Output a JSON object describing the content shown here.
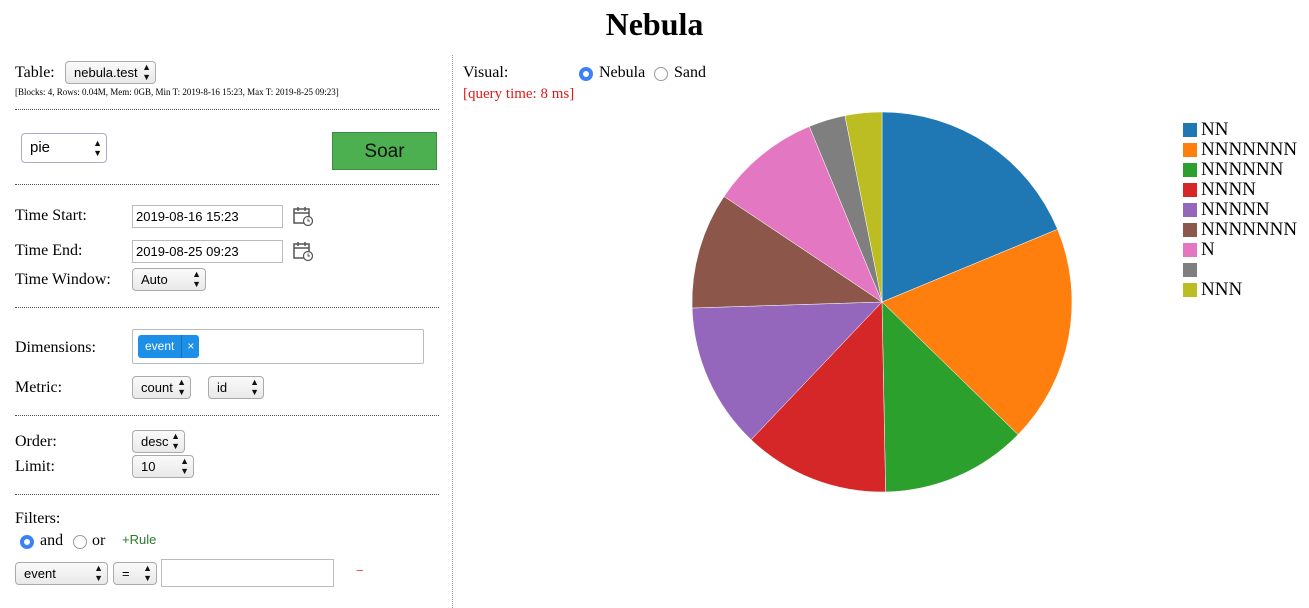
{
  "page": {
    "title": "Nebula"
  },
  "table": {
    "label": "Table:",
    "value": "nebula.test",
    "meta": "[Blocks: 4, Rows: 0.04M, Mem: 0GB, Min T: 2019-8-16 15:23, Max T: 2019-8-25 09:23]"
  },
  "chart_select": {
    "value": "pie"
  },
  "soar_button": {
    "label": "Soar"
  },
  "time": {
    "start_label": "Time Start:",
    "start_value": "2019-08-16 15:23",
    "end_label": "Time End:",
    "end_value": "2019-08-25 09:23",
    "window_label": "Time Window:",
    "window_value": "Auto"
  },
  "dimensions": {
    "label": "Dimensions:",
    "tag": "event",
    "tag_remove": "×"
  },
  "metric": {
    "label": "Metric:",
    "agg_value": "count",
    "field_value": "id"
  },
  "order": {
    "label": "Order:",
    "value": "desc"
  },
  "limit": {
    "label": "Limit:",
    "value": "10"
  },
  "filters": {
    "label": "Filters:",
    "and_label": "and",
    "or_label": "or",
    "add_rule": "+Rule",
    "field_value": "event",
    "op_value": "=",
    "input_value": "",
    "remove": "−"
  },
  "visual": {
    "label": "Visual:",
    "option_nebula": "Nebula",
    "option_sand": "Sand",
    "selected": "Nebula",
    "query_time": "[query time: 8 ms]"
  },
  "colors": {
    "accent": "#1e8fe6",
    "soar": "#4caf50",
    "query_time": "#e01a1a"
  },
  "chart_data": {
    "type": "pie",
    "title": "",
    "legend_placement": "right",
    "slices": [
      {
        "label": "NN",
        "value": 18.6,
        "color": "#1f77b4"
      },
      {
        "label": "NNNNNNN",
        "value": 18.4,
        "color": "#ff7f0e"
      },
      {
        "label": "NNNNNN",
        "value": 12.3,
        "color": "#2ca02c"
      },
      {
        "label": "NNNN",
        "value": 12.3,
        "color": "#d62728"
      },
      {
        "label": "NNNNN",
        "value": 12.3,
        "color": "#9467bd"
      },
      {
        "label": "NNNNNNN",
        "value": 9.8,
        "color": "#8c564b"
      },
      {
        "label": "N",
        "value": 9.3,
        "color": "#e377c2"
      },
      {
        "label": "",
        "value": 3.1,
        "color": "#7f7f7f"
      },
      {
        "label": "NNN",
        "value": 3.1,
        "color": "#bcbd22"
      }
    ]
  }
}
